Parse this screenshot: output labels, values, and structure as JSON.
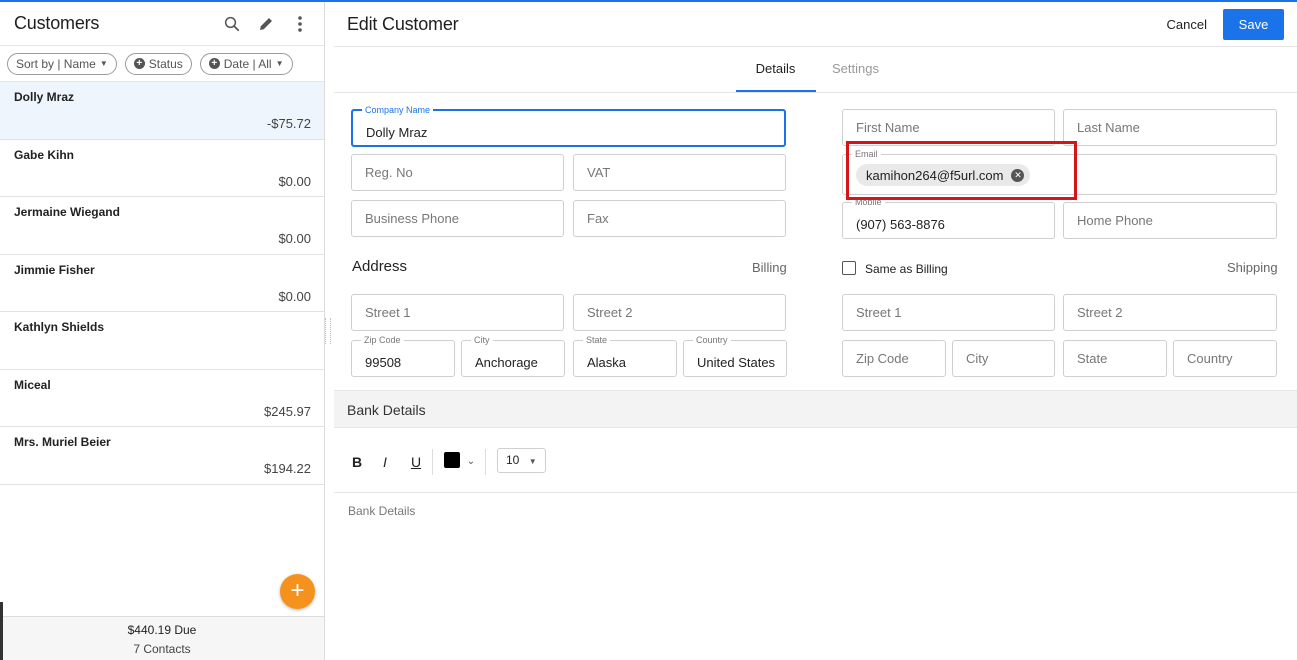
{
  "sidebar": {
    "title": "Customers",
    "filters": {
      "sort": "Sort by | Name",
      "status": "Status",
      "date": "Date | All"
    },
    "customers": [
      {
        "name": "Dolly Mraz",
        "amount": "-$75.72"
      },
      {
        "name": "Gabe Kihn",
        "amount": "$0.00"
      },
      {
        "name": "Jermaine Wiegand",
        "amount": "$0.00"
      },
      {
        "name": "Jimmie Fisher",
        "amount": "$0.00"
      },
      {
        "name": "Kathlyn Shields",
        "amount": ""
      },
      {
        "name": "Miceal",
        "amount": "$245.97"
      },
      {
        "name": "Mrs. Muriel Beier",
        "amount": "$194.22"
      }
    ],
    "fab": "+",
    "footer": {
      "due": "$440.19  Due",
      "contacts": "7 Contacts"
    }
  },
  "header": {
    "title": "Edit Customer",
    "cancel": "Cancel",
    "save": "Save"
  },
  "tabs": {
    "details": "Details",
    "settings": "Settings"
  },
  "form": {
    "company_label": "Company Name",
    "company_value": "Dolly Mraz",
    "reg_no": "Reg. No",
    "vat": "VAT",
    "business_phone": "Business Phone",
    "fax": "Fax",
    "first_name": "First Name",
    "last_name": "Last Name",
    "email_label": "Email",
    "email_value": "kamihon264@f5url.com",
    "mobile_label": "Mobile",
    "mobile_value": "(907) 563-8876",
    "home_phone": "Home Phone"
  },
  "address": {
    "title": "Address",
    "billing": "Billing",
    "same_as_billing": "Same as Billing",
    "shipping": "Shipping",
    "billing_fields": {
      "street1": "Street 1",
      "street2": "Street 2",
      "zip_label": "Zip Code",
      "zip_value": "99508",
      "city_label": "City",
      "city_value": "Anchorage",
      "state_label": "State",
      "state_value": "Alaska",
      "country_label": "Country",
      "country_value": "United States"
    },
    "shipping_fields": {
      "street1": "Street 1",
      "street2": "Street 2",
      "zip": "Zip Code",
      "city": "City",
      "state": "State",
      "country": "Country"
    }
  },
  "bank": {
    "title": "Bank Details",
    "toolbar": {
      "bold": "B",
      "italic": "I",
      "underline": "U",
      "font_color": "#000000",
      "font_size": "10"
    },
    "placeholder": "Bank Details"
  },
  "colors": {
    "accent": "#1a73e8",
    "fab": "#f5921e",
    "highlight": "#d5151c"
  }
}
